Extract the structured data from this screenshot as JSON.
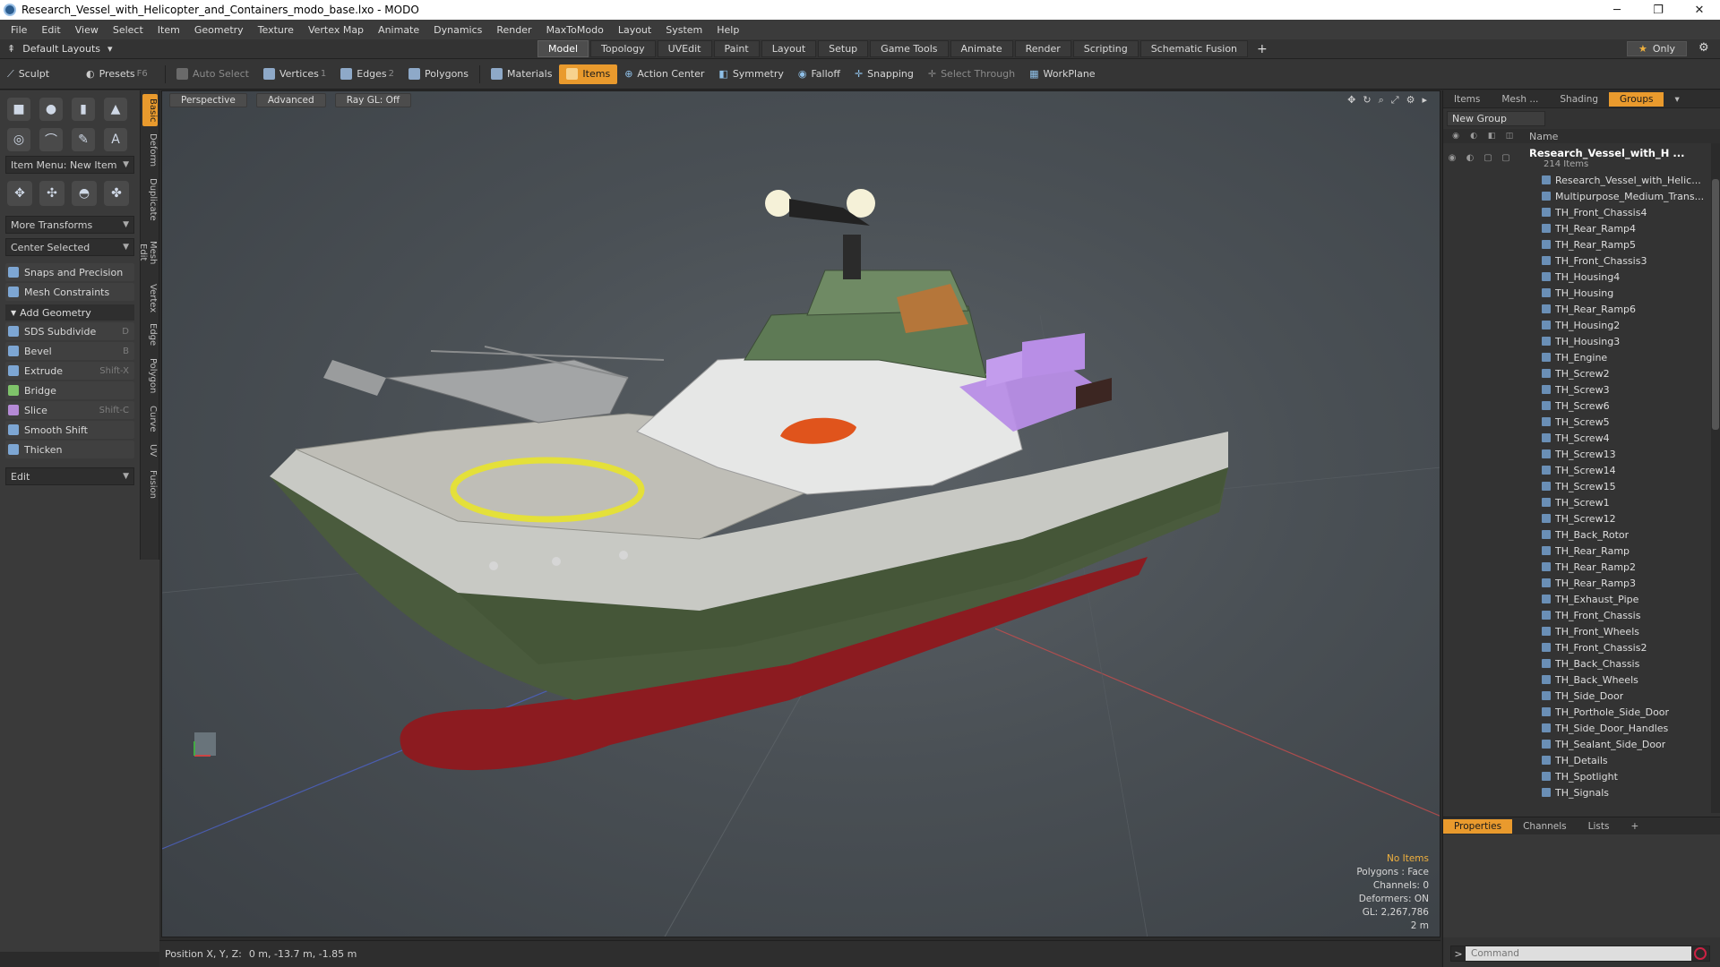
{
  "window": {
    "title": "Research_Vessel_with_Helicopter_and_Containers_modo_base.lxo - MODO",
    "minimize": "─",
    "maximize": "❐",
    "close": "✕"
  },
  "menu": [
    "File",
    "Edit",
    "View",
    "Select",
    "Item",
    "Geometry",
    "Texture",
    "Vertex Map",
    "Animate",
    "Dynamics",
    "Render",
    "MaxToModo",
    "Layout",
    "System",
    "Help"
  ],
  "layouts": {
    "label": "Default Layouts",
    "caret": "▾"
  },
  "tabs": [
    "Model",
    "Topology",
    "UVEdit",
    "Paint",
    "Layout",
    "Setup",
    "Game Tools",
    "Animate",
    "Render",
    "Scripting",
    "Schematic Fusion"
  ],
  "active_tab": "Model",
  "only_label": "Only",
  "toolbar": {
    "sculpt": "Sculpt",
    "presets": "Presets",
    "presets_key": "F6",
    "auto_select": "Auto Select",
    "vertices": "Vertices",
    "vertices_count": "1",
    "edges": "Edges",
    "edges_count": "2",
    "polygons": "Polygons",
    "materials": "Materials",
    "items": "Items",
    "action_center": "Action Center",
    "symmetry": "Symmetry",
    "falloff": "Falloff",
    "snapping": "Snapping",
    "select_through": "Select Through",
    "workplane": "WorkPlane"
  },
  "left": {
    "item_menu": "Item Menu: New Item",
    "more_transforms": "More Transforms",
    "center_selected": "Center Selected",
    "snaps": "Snaps and Precision",
    "mesh_constraints": "Mesh Constraints",
    "add_geometry": "Add Geometry",
    "tools": [
      {
        "label": "SDS Subdivide",
        "shortcut": "D"
      },
      {
        "label": "Bevel",
        "shortcut": "B"
      },
      {
        "label": "Extrude",
        "shortcut": "Shift-X"
      },
      {
        "label": "Bridge",
        "shortcut": ""
      },
      {
        "label": "Slice",
        "shortcut": "Shift-C"
      },
      {
        "label": "Smooth Shift",
        "shortcut": ""
      },
      {
        "label": "Thicken",
        "shortcut": ""
      }
    ],
    "edit": "Edit",
    "vtabs": [
      "Basic",
      "Deform",
      "Duplicate",
      "Mesh Edit",
      "Vertex",
      "Edge",
      "Polygon",
      "Curve",
      "UV",
      "Fusion"
    ]
  },
  "viewport": {
    "perspective": "Perspective",
    "advanced": "Advanced",
    "raygl": "Ray GL: Off",
    "info": {
      "no_items": "No Items",
      "polygons": "Polygons : Face",
      "channels": "Channels: 0",
      "deformers": "Deformers: ON",
      "gl": "GL: 2,267,786",
      "scale": "2 m"
    }
  },
  "status": {
    "label": "Position X, Y, Z:",
    "value": "0 m, -13.7 m, -1.85 m"
  },
  "right": {
    "tabs": [
      "Items",
      "Mesh ...",
      "Shading",
      "Groups"
    ],
    "active_tab": "Groups",
    "new_group": "New Group",
    "name_header": "Name",
    "group_name": "Research_Vessel_with_H ...",
    "group_count": "214 Items",
    "items": [
      "Research_Vessel_with_Helic...",
      "Multipurpose_Medium_Trans...",
      "TH_Front_Chassis4",
      "TH_Rear_Ramp4",
      "TH_Rear_Ramp5",
      "TH_Front_Chassis3",
      "TH_Housing4",
      "TH_Housing",
      "TH_Rear_Ramp6",
      "TH_Housing2",
      "TH_Housing3",
      "TH_Engine",
      "TH_Screw2",
      "TH_Screw3",
      "TH_Screw6",
      "TH_Screw5",
      "TH_Screw4",
      "TH_Screw13",
      "TH_Screw14",
      "TH_Screw15",
      "TH_Screw1",
      "TH_Screw12",
      "TH_Back_Rotor",
      "TH_Rear_Ramp",
      "TH_Rear_Ramp2",
      "TH_Rear_Ramp3",
      "TH_Exhaust_Pipe",
      "TH_Front_Chassis",
      "TH_Front_Wheels",
      "TH_Front_Chassis2",
      "TH_Back_Chassis",
      "TH_Back_Wheels",
      "TH_Side_Door",
      "TH_Porthole_Side_Door",
      "TH_Side_Door_Handles",
      "TH_Sealant_Side_Door",
      "TH_Details",
      "TH_Spotlight",
      "TH_Signals"
    ],
    "props_tabs": [
      "Properties",
      "Channels",
      "Lists"
    ],
    "props_active": "Properties",
    "command_placeholder": "Command"
  }
}
